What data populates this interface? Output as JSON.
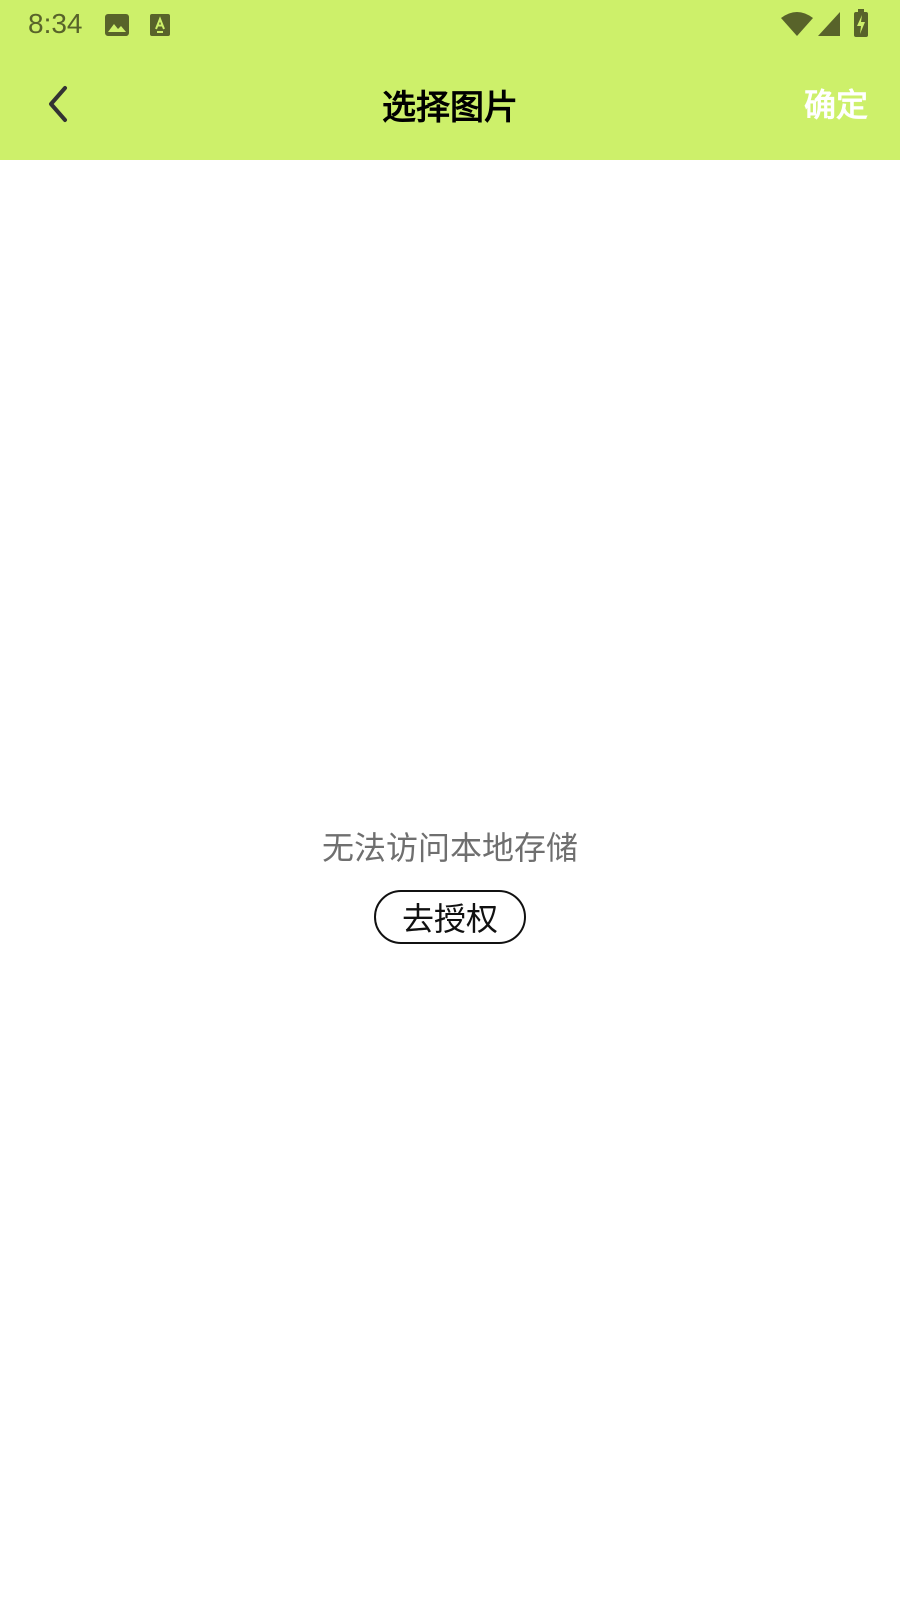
{
  "status_bar": {
    "time": "8:34",
    "icons": [
      "image-notification-icon",
      "font-notification-icon",
      "wifi-icon",
      "signal-icon",
      "battery-charging-icon"
    ]
  },
  "app_bar": {
    "back_icon": "chevron-left-icon",
    "title": "选择图片",
    "confirm_label": "确定"
  },
  "empty_state": {
    "message": "无法访问本地存储",
    "button_label": "去授权"
  },
  "colors": {
    "accent": "#cdf06a",
    "status_icon": "#58632a",
    "message_text": "#6f6f6f"
  }
}
